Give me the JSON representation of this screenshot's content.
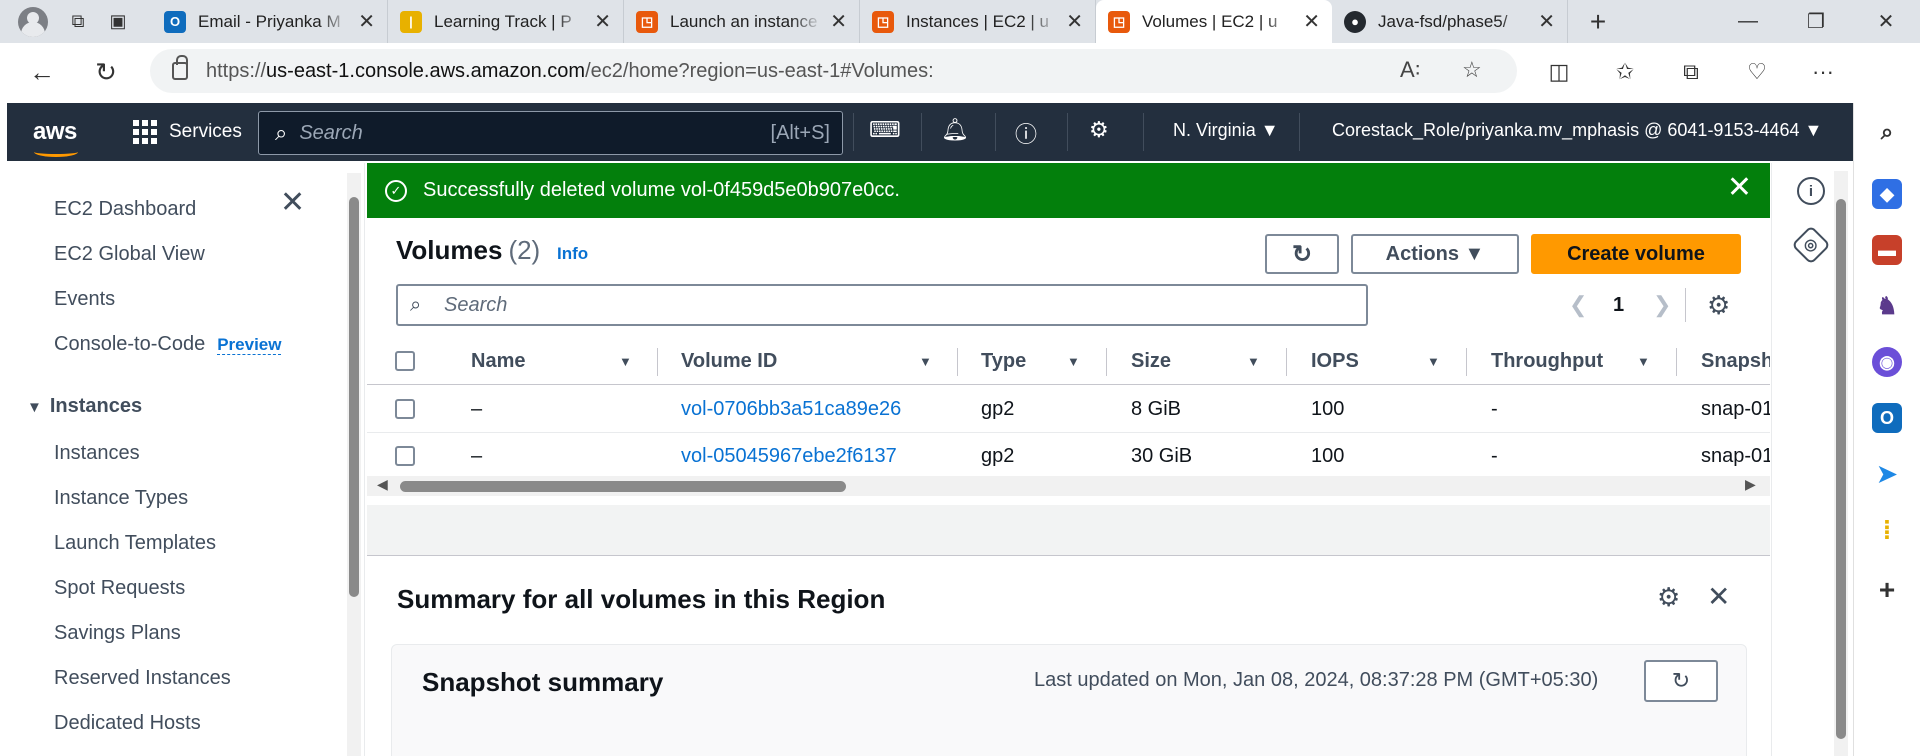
{
  "browser": {
    "tabs": [
      {
        "title": "Email - Priyanka M",
        "favicon_color": "#0f6cbd",
        "favicon_glyph": "O"
      },
      {
        "title": "Learning Track | P",
        "favicon_color": "#e8b100",
        "favicon_glyph": "|"
      },
      {
        "title": "Launch an instance",
        "favicon_color": "#e8590c",
        "favicon_glyph": "◳"
      },
      {
        "title": "Instances | EC2 | u",
        "favicon_color": "#e8590c",
        "favicon_glyph": "◳"
      },
      {
        "title": "Volumes | EC2 | u",
        "favicon_color": "#e8590c",
        "favicon_glyph": "◳",
        "active": true
      },
      {
        "title": "Java-fsd/phase5/",
        "favicon_color": "#24292f",
        "favicon_glyph": "●"
      }
    ],
    "url_prefix": "https://",
    "url_host": "us-east-1.console.aws.amazon.com",
    "url_path": "/ec2/home?region=us-east-1#Volumes:"
  },
  "aws_header": {
    "logo": "aws",
    "services_label": "Services",
    "search_placeholder": "Search",
    "search_shortcut": "[Alt+S]",
    "region": "N. Virginia ▼",
    "account": "Corestack_Role/priyanka.mv_mphasis @ 6041-9153-4464 ▼"
  },
  "leftnav": {
    "items_top": [
      {
        "label": "EC2 Dashboard"
      },
      {
        "label": "EC2 Global View"
      },
      {
        "label": "Events"
      },
      {
        "label": "Console-to-Code",
        "badge": "Preview"
      }
    ],
    "section": "Instances",
    "section_items": [
      "Instances",
      "Instance Types",
      "Launch Templates",
      "Spot Requests",
      "Savings Plans",
      "Reserved Instances",
      "Dedicated Hosts"
    ]
  },
  "flash": {
    "message": "Successfully deleted volume vol-0f459d5e0b907e0cc.",
    "color": "#037f0c"
  },
  "volumes": {
    "title": "Volumes",
    "count": "(2)",
    "info": "Info",
    "actions_label": "Actions ▼",
    "create_label": "Create volume",
    "search_placeholder": "Search",
    "page": "1",
    "columns": [
      "Name",
      "Volume ID",
      "Type",
      "Size",
      "IOPS",
      "Throughput",
      "Snapsh"
    ],
    "rows": [
      {
        "name": "–",
        "volume_id": "vol-0706bb3a51ca89e26",
        "type": "gp2",
        "size": "8 GiB",
        "iops": "100",
        "throughput": "-",
        "snapshot": "snap-01"
      },
      {
        "name": "–",
        "volume_id": "vol-05045967ebe2f6137",
        "type": "gp2",
        "size": "30 GiB",
        "iops": "100",
        "throughput": "-",
        "snapshot": "snap-01"
      }
    ]
  },
  "summary": {
    "title": "Summary for all volumes in this Region",
    "card_title": "Snapshot summary",
    "last_updated": "Last updated on Mon, Jan 08, 2024, 08:37:28 PM (GMT+05:30)"
  }
}
